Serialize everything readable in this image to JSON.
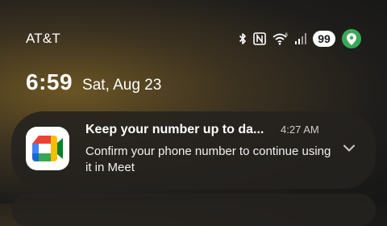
{
  "status_bar": {
    "carrier": "AT&T",
    "battery_level": "99",
    "icons": [
      "bluetooth-icon",
      "nfc-icon",
      "wifi-icon",
      "cell-signal-icon",
      "location-icon"
    ],
    "wifi_badge": "6",
    "location_color": "#3aa857"
  },
  "lock_screen": {
    "time": "6:59",
    "date": "Sat, Aug 23"
  },
  "notification": {
    "app": "Google Meet",
    "app_icon": "google-meet-icon",
    "title": "Keep your number up to da...",
    "time": "4:27 AM",
    "body": "Confirm your phone number to continue using it in Meet",
    "expand_icon": "chevron-down-icon"
  }
}
